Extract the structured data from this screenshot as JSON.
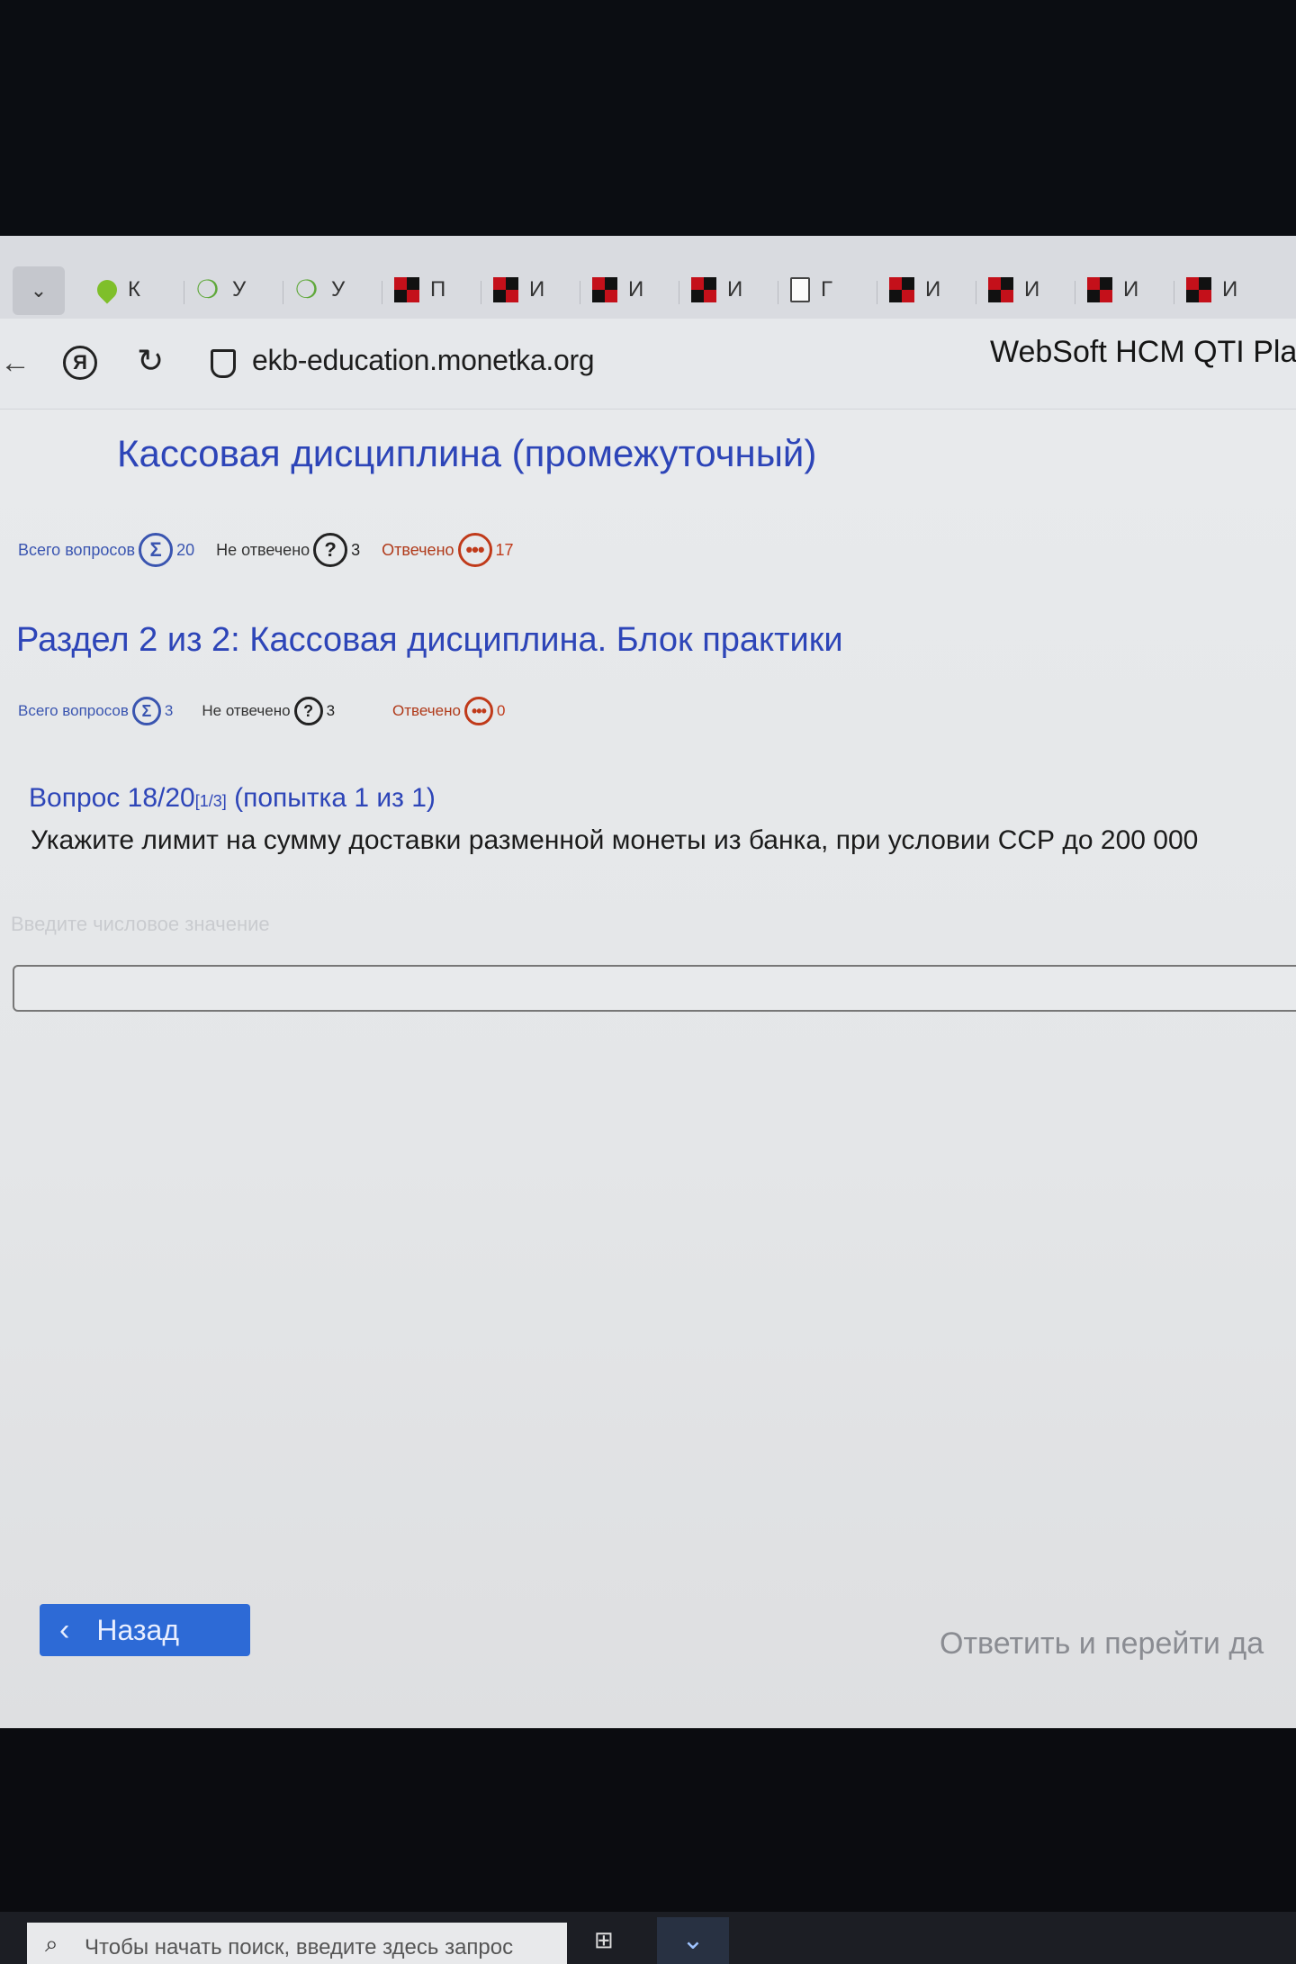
{
  "browser": {
    "tabs": [
      {
        "label": "К",
        "icon": "map-marker-icon"
      },
      {
        "label": "У",
        "icon": "apple-icon"
      },
      {
        "label": "У",
        "icon": "apple-icon"
      },
      {
        "label": "П",
        "icon": "red-logo-icon"
      },
      {
        "label": "И",
        "icon": "red-logo-icon"
      },
      {
        "label": "И",
        "icon": "red-logo-icon"
      },
      {
        "label": "И",
        "icon": "red-logo-icon"
      },
      {
        "label": "Г",
        "icon": "document-icon"
      },
      {
        "label": "И",
        "icon": "red-logo-icon"
      },
      {
        "label": "И",
        "icon": "red-logo-icon"
      },
      {
        "label": "И",
        "icon": "red-logo-icon"
      },
      {
        "label": "И",
        "icon": "red-logo-icon"
      }
    ],
    "url": "ekb-education.monetka.org",
    "page_title": "WebSoft HCM QTI Playe"
  },
  "test": {
    "title": "Кассовая дисциплина (промежуточный)",
    "stats": {
      "total_label": "Всего вопросов",
      "total": "20",
      "unanswered_label": "Не отвечено",
      "unanswered": "3",
      "answered_label": "Отвечено",
      "answered": "17"
    }
  },
  "section": {
    "title": "Раздел 2 из 2: Кассовая дисциплина. Блок практики",
    "stats": {
      "total_label": "Всего вопросов",
      "total": "3",
      "unanswered_label": "Не отвечено",
      "unanswered": "3",
      "answered_label": "Отвечено",
      "answered": "0"
    }
  },
  "question": {
    "number": "Вопрос 18/20",
    "sub": "[1/3]",
    "attempt": "(попытка 1 из 1)",
    "text": "Укажите лимит на сумму доставки разменной монеты из банка, при условии ССР до 200 000",
    "hint": "Введите числовое значение"
  },
  "nav": {
    "back_label": "Назад",
    "submit_label": "Ответить и перейти да"
  },
  "taskbar": {
    "search_placeholder": "Чтобы начать поиск, введите здесь запрос"
  }
}
